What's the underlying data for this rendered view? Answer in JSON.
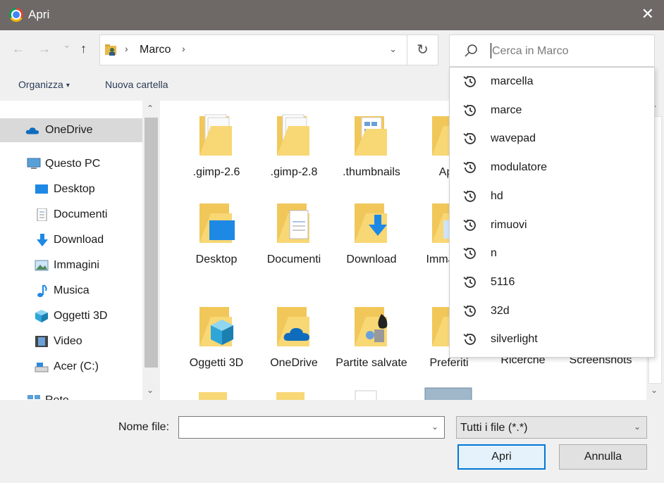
{
  "window": {
    "title": "Apri",
    "close_glyph": "✕"
  },
  "nav": {
    "back_glyph": "←",
    "forward_glyph": "→",
    "recent_glyph": "⌄",
    "up_glyph": "↑",
    "breadcrumb": [
      "Marco"
    ],
    "sep_glyph": "›",
    "address_dropdown_glyph": "⌄",
    "refresh_glyph": "↻"
  },
  "search": {
    "placeholder": "Cerca in Marco"
  },
  "toolbar": {
    "organize_label": "Organizza",
    "organize_arrow": "▾",
    "new_folder_label": "Nuova cartella"
  },
  "sidebar": {
    "items": [
      {
        "label": "OneDrive",
        "icon": "onedrive-cloud-icon",
        "selected": true
      },
      {
        "label": "Questo PC",
        "icon": "computer-icon"
      },
      {
        "label": "Desktop",
        "icon": "desktop-icon"
      },
      {
        "label": "Documenti",
        "icon": "documents-icon"
      },
      {
        "label": "Download",
        "icon": "download-arrow-icon"
      },
      {
        "label": "Immagini",
        "icon": "pictures-icon"
      },
      {
        "label": "Musica",
        "icon": "music-note-icon"
      },
      {
        "label": "Oggetti 3D",
        "icon": "cube-3d-icon"
      },
      {
        "label": "Video",
        "icon": "film-icon"
      },
      {
        "label": "Acer (C:)",
        "icon": "drive-icon"
      },
      {
        "label": "Rete",
        "icon": "network-icon"
      }
    ],
    "scroll_up": "⌃",
    "scroll_down": "⌄"
  },
  "folders": [
    {
      "name": ".gimp-2.6",
      "icon": "folder-with-documents-icon"
    },
    {
      "name": ".gimp-2.8",
      "icon": "folder-with-documents-icon"
    },
    {
      "name": ".thumbnails",
      "icon": "folder-with-thumbnails-icon"
    },
    {
      "name": "App",
      "icon": "folder-icon"
    },
    {
      "name": "Desktop",
      "icon": "desktop-folder-icon"
    },
    {
      "name": "Documenti",
      "icon": "documents-folder-icon"
    },
    {
      "name": "Download",
      "icon": "downloads-folder-icon"
    },
    {
      "name": "Immagini",
      "icon": "pictures-folder-icon"
    },
    {
      "name": "Oggetti 3D",
      "icon": "3d-objects-folder-icon"
    },
    {
      "name": "OneDrive",
      "icon": "onedrive-folder-icon"
    },
    {
      "name": "Partite salvate",
      "icon": "saved-games-folder-icon"
    },
    {
      "name": "Preferiti",
      "icon": "favorites-folder-icon"
    },
    {
      "name": "Ricerche",
      "icon": "searches-folder-icon"
    },
    {
      "name": "Screenshots",
      "icon": "screenshots-folder-icon"
    }
  ],
  "suggestions": [
    "marcella",
    "marce",
    "wavepad",
    "modulatore",
    "hd",
    "rimuovi",
    "n",
    "5116",
    "32d",
    "silverlight"
  ],
  "bottom": {
    "filename_label": "Nome file:",
    "filename_value": "",
    "filter_value": "Tutti i file (*.*)",
    "dropdown_glyph": "⌄",
    "open_label": "Apri",
    "cancel_label": "Annulla"
  },
  "colors": {
    "titlebar": "#6e6967",
    "folder": "#f8d775",
    "accent": "#0078d7",
    "onedrive": "#0f6cbd"
  }
}
